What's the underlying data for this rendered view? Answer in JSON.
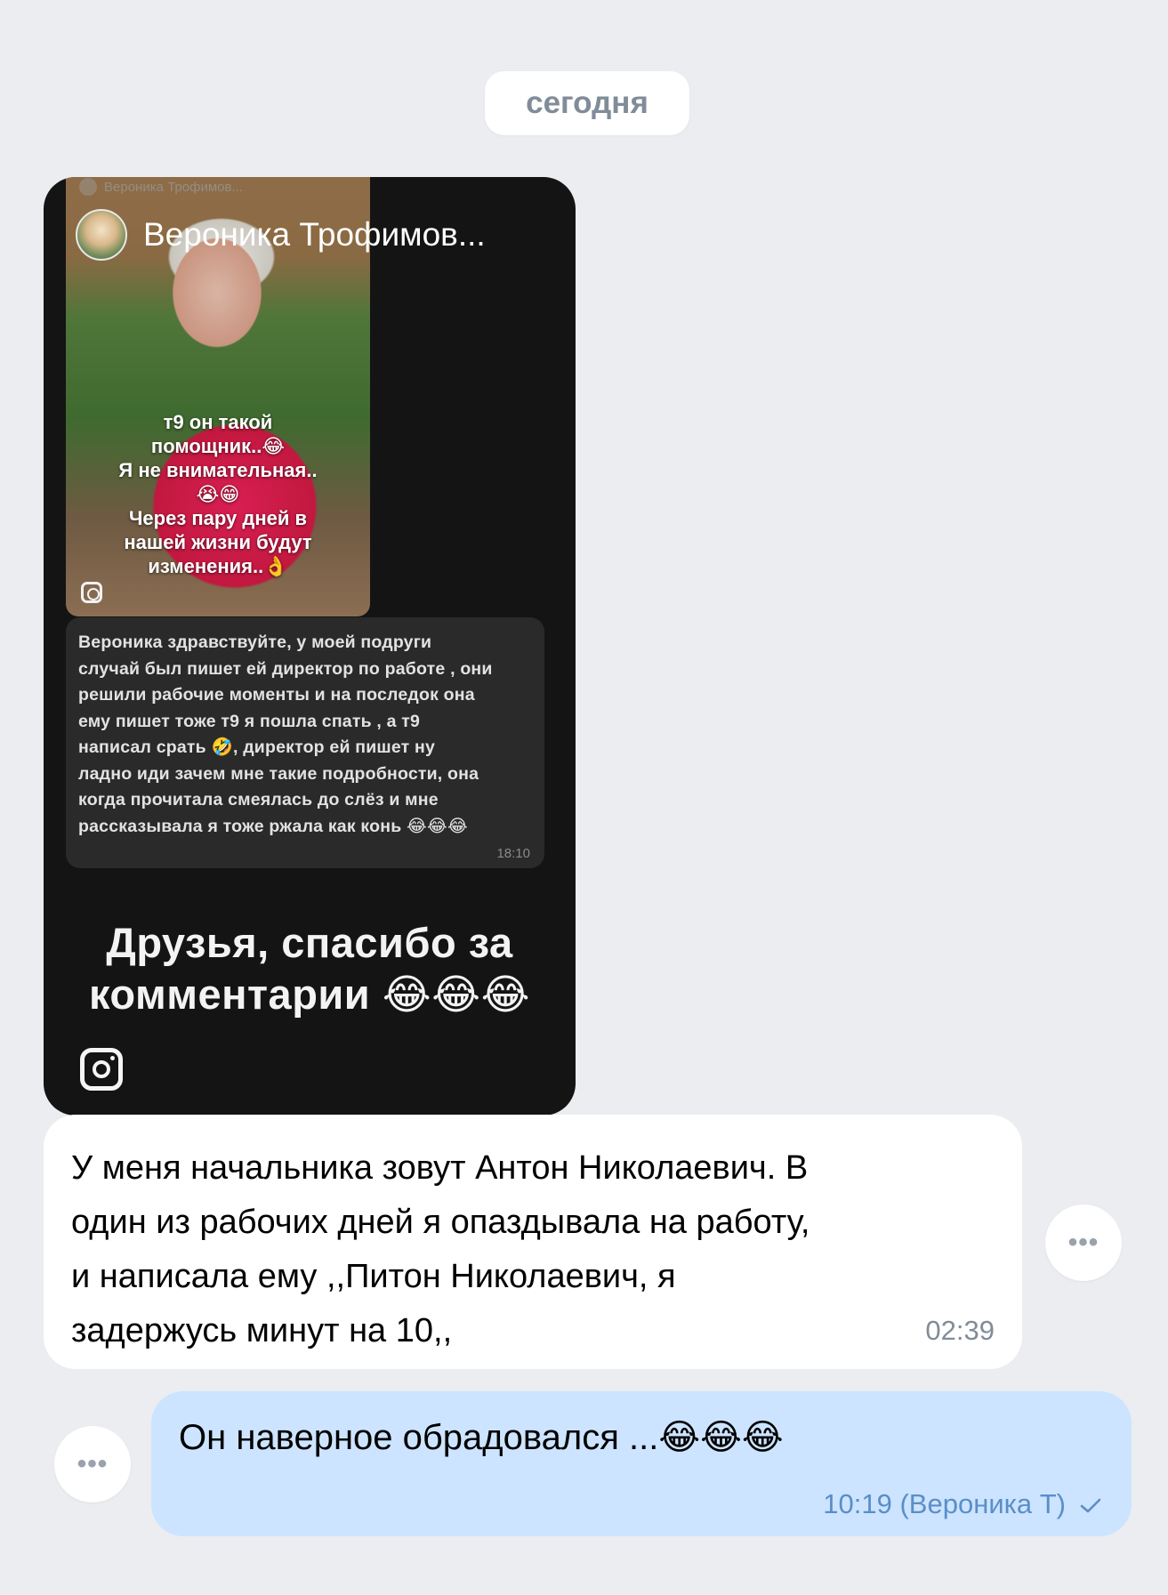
{
  "date_separator": "сегодня",
  "story": {
    "faded_author": "Вероника Трофимов...",
    "author": "Вероника Трофимов...",
    "photo_caption": [
      "т9 он такой",
      "помощник..😂",
      "Я не внимательная..",
      "😭😁",
      "Через пару дней в",
      "нашей жизни будут",
      "изменения..👌"
    ],
    "inner_message": {
      "lines": [
        "Вероника здравствуйте, у моей подруги",
        "случай был пишет ей директор по работе , они",
        "решили рабочие моменты и на последок она",
        "ему пишет тоже т9 я пошла спать , а т9",
        "написал срать 🤣, директор ей пишет ну",
        "ладно иди зачем мне такие подробности, она",
        "когда прочитала смеялась до слёз и мне",
        "рассказывала я тоже ржала как конь 😂😂😂"
      ],
      "time": "18:10"
    },
    "caption_lines": [
      "Друзья, спасибо за",
      "комментарии 😂😂😂"
    ]
  },
  "incoming_message": {
    "lines": [
      "У меня начальника зовут Антон Николаевич. В",
      "один из рабочих дней я опаздывала на работу,",
      "и написала ему ,,Питон Николаевич, я",
      "задержусь минут на 10,,"
    ],
    "time": "02:39"
  },
  "outgoing_message": {
    "text": "Он наверное обрадовался ...😂😂😂",
    "meta": "10:19 (Вероника Т)"
  },
  "more_button_label": "•••",
  "colors": {
    "background": "#ebedf0",
    "incoming_bubble": "#ffffff",
    "outgoing_bubble": "#cce4ff",
    "meta_text": "#818c99",
    "outgoing_meta": "#5a8ec8",
    "story_background": "#141414"
  },
  "icons": [
    "instagram-icon",
    "more-icon",
    "read-check-icon",
    "avatar"
  ]
}
